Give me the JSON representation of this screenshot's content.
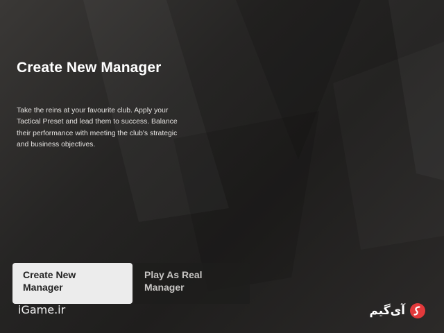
{
  "screen": {
    "title": "Create New Manager",
    "description": "Take the reins at your favourite club. Apply your Tactical Preset and lead them to success. Balance their performance with meeting the club's strategic and business objectives."
  },
  "options": [
    {
      "label": "Create New Manager",
      "selected": true
    },
    {
      "label": "Play As Real Manager",
      "selected": false
    }
  ],
  "watermarks": {
    "left": "iGame.ir",
    "right": "آی‌گیم",
    "logo_icon": "igame-logo-icon"
  },
  "colors": {
    "selected_bg": "#ececec",
    "selected_text": "#222222",
    "logo_red": "#e2393b"
  }
}
